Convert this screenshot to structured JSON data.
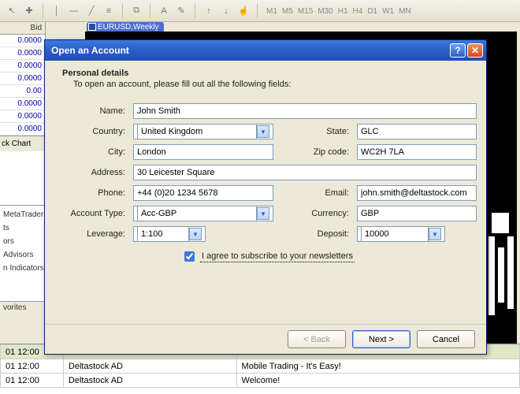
{
  "toolbar": {
    "periods": [
      "M1",
      "M5",
      "M15",
      "M30",
      "H1",
      "H4",
      "D1",
      "W1",
      "MN"
    ]
  },
  "market_watch": {
    "header": "Bid",
    "values": [
      "0.0000",
      "0.0000",
      "0.0000",
      "0.0000",
      "0.00",
      "0.0000",
      "0.0000",
      "0.0000"
    ],
    "tab_label": "ck Chart"
  },
  "navigator": {
    "items": [
      "MetaTrader",
      "ts",
      "ors",
      "Advisors",
      "n Indicators"
    ],
    "tab_label": "vorites"
  },
  "chart": {
    "tab_label": "EURUSD,Weekly"
  },
  "mail": {
    "rows": [
      {
        "time": "01 12:00",
        "from": "",
        "subject": ""
      },
      {
        "time": "01 12:00",
        "from": "Deltastock AD",
        "subject": "Mobile Trading - It's Easy!"
      },
      {
        "time": "01 12:00",
        "from": "Deltastock AD",
        "subject": "Welcome!"
      }
    ]
  },
  "dialog": {
    "title": "Open an Account",
    "heading": "Personal details",
    "subheading": "To open an account, please fill out all the following fields:",
    "labels": {
      "name": "Name:",
      "country": "Country:",
      "state": "State:",
      "city": "City:",
      "zip": "Zip code:",
      "address": "Address:",
      "phone": "Phone:",
      "email": "Email:",
      "acct": "Account Type:",
      "currency": "Currency:",
      "leverage": "Leverage:",
      "deposit": "Deposit:"
    },
    "values": {
      "name": "John Smith",
      "country": "United Kingdom",
      "state": "GLC",
      "city": "London",
      "zip": "WC2H 7LA",
      "address": "30 Leicester Square",
      "phone": "+44 (0)20 1234 5678",
      "email": "john.smith@deltastock.com",
      "acct": "Acc-GBP",
      "currency": "GBP",
      "leverage": "1:100",
      "deposit": "10000"
    },
    "agree_checked": true,
    "agree_label": "I agree to subscribe to your newsletters",
    "buttons": {
      "back": "< Back",
      "next": "Next >",
      "cancel": "Cancel"
    }
  }
}
